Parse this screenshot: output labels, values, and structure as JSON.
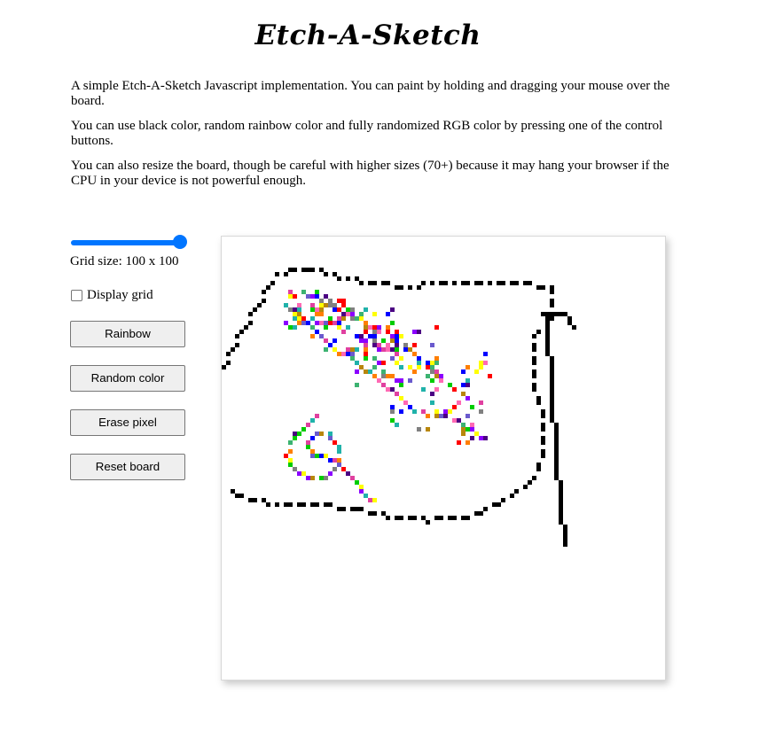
{
  "title": "Etch-A-Sketch",
  "intro": [
    "A simple Etch-A-Sketch Javascript implementation. You can paint by holding and dragging your mouse over the board.",
    "You can use black color, random rainbow color and fully randomized RGB color by pressing one of the control buttons.",
    "You can also resize the board, though be careful with higher sizes (70+) because it may hang your browser if the CPU in your device is not powerful enough."
  ],
  "controls": {
    "slider": {
      "value": 100,
      "min": 1,
      "max": 100
    },
    "grid_size_label": "Grid size: 100 x 100",
    "display_grid_label": "Display grid",
    "display_grid_checked": false,
    "buttons": [
      "Rainbow",
      "Random color",
      "Erase pixel",
      "Reset board"
    ]
  },
  "colors": {
    "accent": "#0075ff",
    "ink": "#000000",
    "rainbow": [
      "#ff0000",
      "#ff7f00",
      "#ffff00",
      "#00cc00",
      "#0000ff",
      "#4b0082",
      "#8b00ff",
      "#e040a0",
      "#3cb371",
      "#20b2aa",
      "#b8860b",
      "#ff69b4",
      "#6a5acd",
      "#808080"
    ]
  },
  "board": {
    "grid_size": 100
  }
}
